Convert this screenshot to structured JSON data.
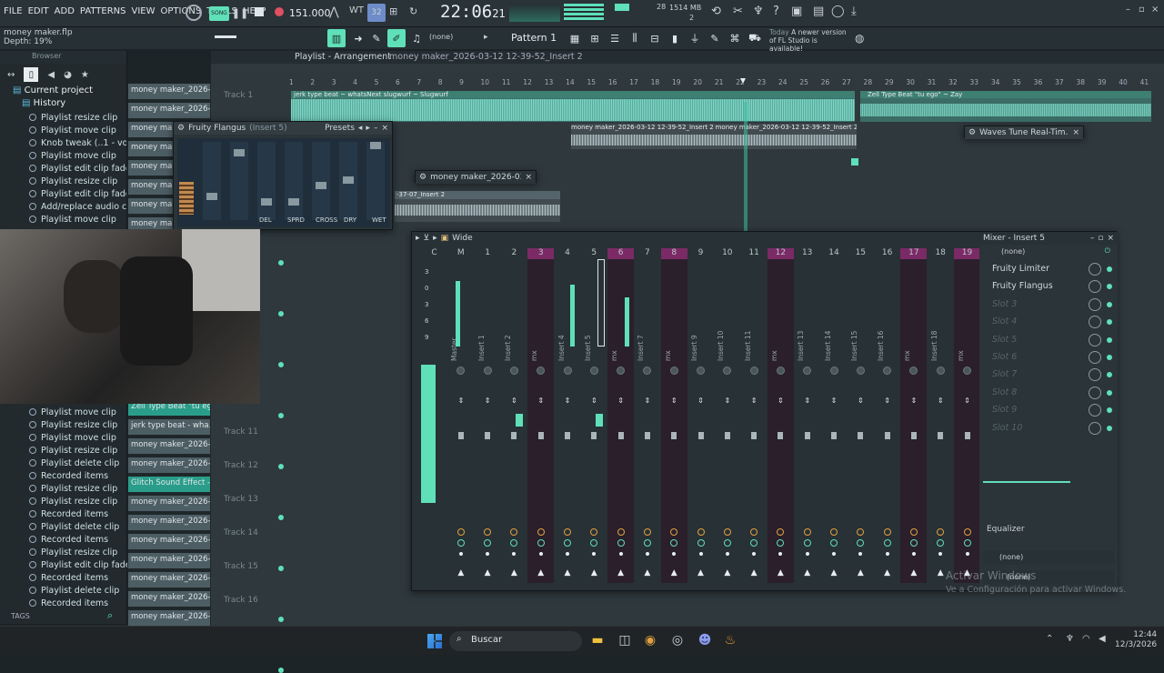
{
  "menu": [
    "FILE",
    "EDIT",
    "ADD",
    "PATTERNS",
    "VIEW",
    "OPTIONS",
    "TOOLS",
    "HELP"
  ],
  "song_toggle": "SONG",
  "tempo": "151.000",
  "time": "22:06",
  "time_sub": "21",
  "cpu": "28",
  "ram": "1514 MB",
  "ram_sub": "2",
  "project": {
    "file": "money maker.flp",
    "depth": "Depth: 19%"
  },
  "pattern": "Pattern 1",
  "snap": "(none)",
  "news": {
    "today": "Today",
    "msg": "A newer version of FL Studio is available!"
  },
  "browser": {
    "title": "Browser",
    "current_project": "Current project",
    "history": "History",
    "items_top": [
      "Playlist resize clip",
      "Playlist move clip",
      "Knob tweak (..1 - volume)",
      "Playlist move clip",
      "Playlist edit clip fade",
      "Playlist resize clip",
      "Playlist edit clip fade",
      "Add/replace audio clip",
      "Playlist move clip"
    ],
    "items_bottom": [
      "Playlist move clip",
      "Playlist resize clip",
      "Playlist move clip",
      "Playlist resize clip",
      "Playlist delete clip",
      "Recorded items",
      "Playlist resize clip",
      "Playlist resize clip",
      "Recorded items",
      "Playlist delete clip",
      "Recorded items",
      "Playlist resize clip",
      "Playlist edit clip fade",
      "Recorded items",
      "Playlist delete clip",
      "Recorded items"
    ],
    "tags": "TAGS"
  },
  "clips_top": [
    "money maker_2026-03",
    "money maker_2026-03-...",
    "money mak",
    "money mak",
    "money mak",
    "money mak",
    "money mak",
    "money mak"
  ],
  "clips_bottom": [
    {
      "label": "Zell Type Beat \"tu eg...",
      "teal": true
    },
    {
      "label": "jerk type beat - wha...",
      "teal": false
    },
    {
      "label": "money maker_2026-03-...",
      "teal": false
    },
    {
      "label": "money maker_2026-03-...",
      "teal": false
    },
    {
      "label": "Glitch Sound Effect -...",
      "teal": true
    },
    {
      "label": "money maker_2026-03-...",
      "teal": false
    },
    {
      "label": "money maker_2026-03-...",
      "teal": false
    },
    {
      "label": "money maker_2026-03-...",
      "teal": false
    },
    {
      "label": "money maker_2026-03-...",
      "teal": false
    },
    {
      "label": "money maker_2026-03-...",
      "teal": false
    },
    {
      "label": "money maker_2026-03-...",
      "teal": false
    },
    {
      "label": "money maker_2026-03-...",
      "teal": false
    }
  ],
  "playlist": {
    "title": "Playlist - Arrangement",
    "crumb": "money maker_2026-03-12 12-39-52_Insert 2",
    "ruler": [
      "1",
      "2",
      "3",
      "4",
      "5",
      "6",
      "7",
      "8",
      "9",
      "10",
      "11",
      "12",
      "13",
      "14",
      "15",
      "16",
      "17",
      "18",
      "19",
      "20",
      "21",
      "22",
      "23",
      "24",
      "25",
      "26",
      "27",
      "28",
      "29",
      "30",
      "31",
      "32",
      "33",
      "34",
      "35",
      "36",
      "37",
      "38",
      "39",
      "40",
      "41"
    ],
    "track1": "Track 1",
    "tracks": [
      "Track 11",
      "Track 12",
      "Track 13",
      "Track 14",
      "Track 15",
      "Track 16"
    ],
    "clip_jerk": "jerk type beat ~ whatsNext slugwurf ~ Slugwurf",
    "clip_zell": "Zell Type Beat \"tu ego\" ~ Zay",
    "clip_mm1": "money maker_2026-03-12 12-39-52_Insert 2",
    "clip_mm2": "money maker_2026-03-12 12-39-52_Insert 2",
    "clip_mm3": "-37-07_Insert 2"
  },
  "flangus": {
    "title": "Fruity Flangus",
    "insert": "(Insert 5)",
    "presets": "Presets",
    "labels": [
      "DEL",
      "SPRD",
      "CROSS",
      "DRY",
      "WET"
    ]
  },
  "mm_small": "money maker_2026-03-1...",
  "waves": "Waves Tune Real-Tim...",
  "mixer": {
    "title": "Mixer - Insert 5",
    "wide": "Wide",
    "header": [
      "C",
      "M",
      "1",
      "2",
      "3",
      "4",
      "5",
      "6",
      "7",
      "8",
      "9",
      "10",
      "11",
      "12",
      "13",
      "14",
      "15",
      "16",
      "17",
      "18",
      "19"
    ],
    "names": [
      "Master",
      "Insert 1",
      "Insert 2",
      "mx",
      "Insert 4",
      "Insert 5",
      "mx",
      "Insert 7",
      "mx",
      "Insert 9",
      "Insert 10",
      "Insert 11",
      "mx",
      "Insert 13",
      "Insert 14",
      "Insert 15",
      "Insert 16",
      "mx",
      "Insert 18",
      "mx"
    ],
    "scale": [
      "3",
      "0",
      "3",
      "6",
      "9"
    ],
    "fx_none": "(none)",
    "slots": [
      "Fruity Limiter",
      "Fruity Flangus",
      "Slot 3",
      "Slot 4",
      "Slot 5",
      "Slot 6",
      "Slot 7",
      "Slot 8",
      "Slot 9",
      "Slot 10"
    ],
    "eq": "Equalizer",
    "out1": "(none)",
    "out2": "(none)"
  },
  "activate": {
    "title": "Activar Windows",
    "sub": "Ve a Configuración para activar Windows."
  },
  "taskbar": {
    "search": "Buscar",
    "clock": "12:44",
    "date": "12/3/2026"
  }
}
